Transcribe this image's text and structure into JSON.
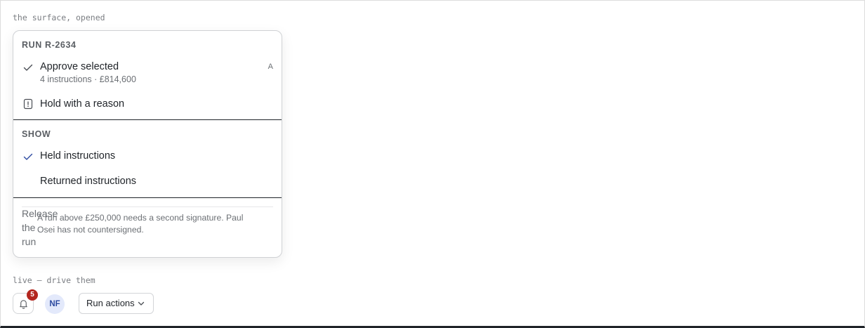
{
  "captions": {
    "top": "the surface, opened",
    "live": "live — drive them"
  },
  "menu": {
    "run_group_label": "RUN R-2634",
    "approve": {
      "label": "Approve selected",
      "sub": "4 instructions · £814,600",
      "shortcut": "A",
      "icon": "check-icon",
      "checked": true
    },
    "hold": {
      "label": "Hold with a reason",
      "icon": "hold-icon"
    },
    "show_group_label": "SHOW",
    "show_items": [
      {
        "label": "Held instructions",
        "checked": true
      },
      {
        "label": "Returned instructions",
        "checked": false
      }
    ],
    "release": {
      "title": "Release the run",
      "text": "A run above £250,000 needs a second signature. Paul Osei has not countersigned."
    }
  },
  "toolbar": {
    "notification_count": "5",
    "avatar_initials": "NF",
    "run_actions_label": "Run actions"
  },
  "colors": {
    "badge": "#b3261e",
    "avatar_bg": "#e3e9fb",
    "avatar_text": "#2d4aa0",
    "check": "#2d4aa0"
  }
}
